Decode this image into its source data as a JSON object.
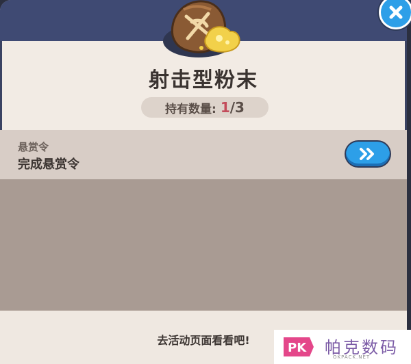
{
  "item": {
    "name": "射击型粉末",
    "icon": "powder-sack-icon",
    "holding_label": "持有数量:",
    "holding_current": "1",
    "holding_total": "/3"
  },
  "source": {
    "category": "悬赏令",
    "name": "完成悬赏令",
    "go_button_icon": "double-chevron-right-icon"
  },
  "footer": {
    "hint": "去活动页面看看吧!"
  },
  "close_button_icon": "close-icon",
  "watermark": {
    "logo_text": "PK",
    "name": "帕克数码",
    "domain": "OKPACK.NET"
  },
  "colors": {
    "header": "#3f4a73",
    "panel": "#f2ebe4",
    "source_row": "#d8cdc6",
    "empty_area": "#a99b93",
    "accent_blue": "#2d9fe8",
    "count_red": "#c34b5a"
  }
}
